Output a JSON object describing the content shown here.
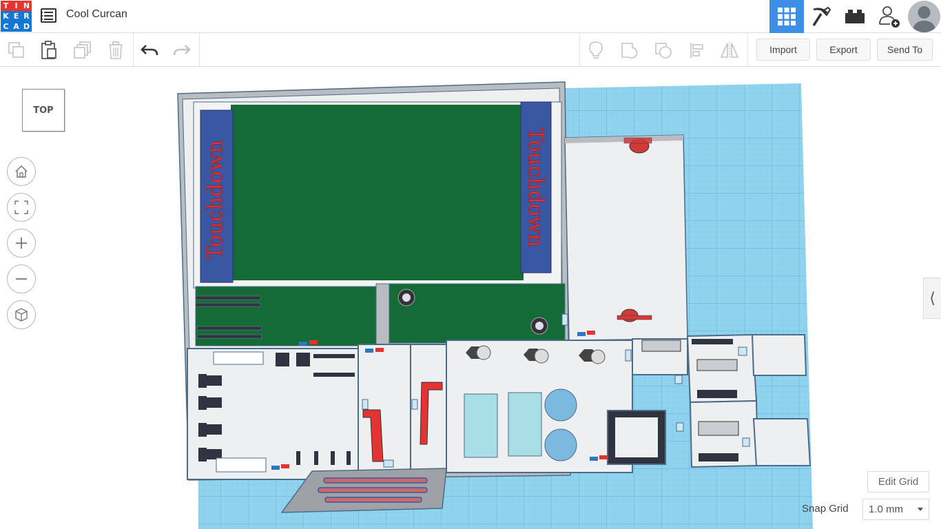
{
  "app": {
    "logo_letters": [
      "T",
      "I",
      "N",
      "K",
      "E",
      "R",
      "C",
      "A",
      "D"
    ],
    "logo_colors": [
      "#e5362e",
      "#e5362e",
      "#e5362e",
      "#1477d4",
      "#1477d4",
      "#1477d4",
      "#1477d4",
      "#1477d4",
      "#1477d4"
    ],
    "design_title": "Cool Curcan"
  },
  "topbar": {
    "icons": [
      "3d-view-icon",
      "pickaxe-icon",
      "brick-icon",
      "add-user-icon"
    ],
    "active_color": "#3d8ee8"
  },
  "toolbar": {
    "import_label": "Import",
    "export_label": "Export",
    "sendto_label": "Send To"
  },
  "viewport": {
    "viewcube_label": "TOP",
    "edit_grid_label": "Edit Grid",
    "snap_grid_label": "Snap Grid",
    "snap_grid_value": "1.0 mm",
    "workplane_color": "#8fd3ef",
    "field_color": "#146b38",
    "endzone_color": "#3a57a4",
    "endzone_text_left": "Touchdown",
    "endzone_text_right": "Touchdown",
    "endzone_text_color": "#e53233"
  }
}
